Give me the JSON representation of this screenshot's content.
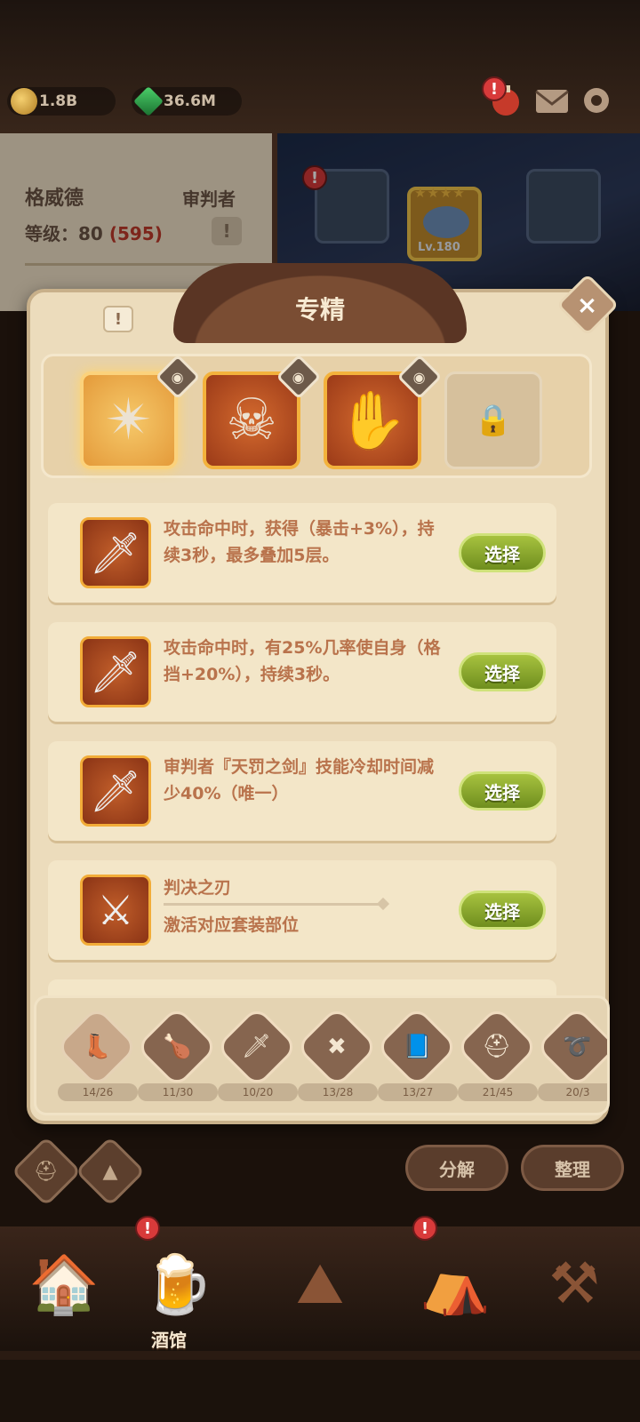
{
  "currencies": {
    "gold": "1.8B",
    "gem": "36.6M"
  },
  "hero": {
    "name": "格威德",
    "class": "审判者",
    "level_label": "等级：",
    "level": "80",
    "level_extra": "(595)",
    "info": "!"
  },
  "equipment": {
    "level_tag": "Lv.180"
  },
  "modal": {
    "title": "专精",
    "info": "!",
    "close": "×",
    "spec_slots": [
      {
        "name": "shuriken",
        "glyph": "✴"
      },
      {
        "name": "skull-blade",
        "glyph": "☠"
      },
      {
        "name": "gauntlet",
        "glyph": "✋"
      }
    ],
    "lock_glyph": "🔒",
    "eye_glyph": "◉",
    "options": [
      {
        "text": "攻击命中时，获得（暴击+3%），持续3秒，最多叠加5层。",
        "button": "选择",
        "glyph": "🗡"
      },
      {
        "text": "攻击命中时，有25%几率使自身（格挡+20%），持续3秒。",
        "button": "选择",
        "glyph": "🗡"
      },
      {
        "text": "审判者『天罚之剑』技能冷却时间减少40%（唯一）",
        "button": "选择",
        "glyph": "🗡"
      },
      {
        "title": "判决之刃",
        "text": "激活对应套装部位",
        "button": "选择",
        "glyph": "⚔"
      }
    ]
  },
  "categories": [
    {
      "icon": "boot",
      "glyph": "👢",
      "count": "14/26"
    },
    {
      "icon": "drumstick",
      "glyph": "🍗",
      "count": "11/30"
    },
    {
      "icon": "sword",
      "glyph": "🗡",
      "count": "10/20"
    },
    {
      "icon": "cross-shield",
      "glyph": "✖",
      "count": "13/28"
    },
    {
      "icon": "book",
      "glyph": "📘",
      "count": "13/27"
    },
    {
      "icon": "horned-helmet",
      "glyph": "⛑",
      "count": "21/45"
    },
    {
      "icon": "lasso",
      "glyph": "➰",
      "count": "20/3"
    }
  ],
  "actions": {
    "disassemble": "分解",
    "organize": "整理"
  },
  "nav": {
    "tavern": "酒馆"
  },
  "alert": "!"
}
